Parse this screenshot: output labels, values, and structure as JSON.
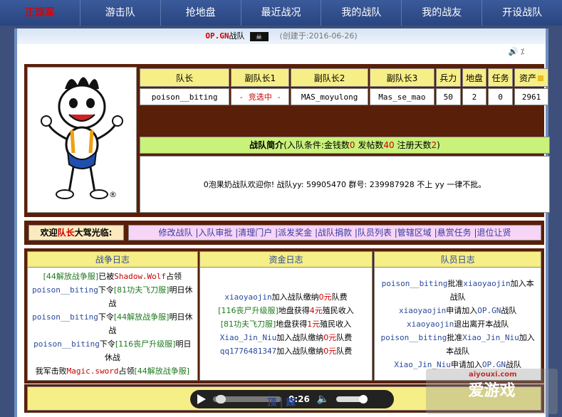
{
  "nav": {
    "items": [
      "正规军",
      "游击队",
      "抢地盘",
      "最近战况",
      "我的战队",
      "我的战友",
      "开设战队"
    ]
  },
  "header": {
    "team_code": "OP.GN",
    "team_suffix": "战队",
    "created": "(创建于:2016-06-26)"
  },
  "stats": {
    "headers": [
      "队长",
      "副队长1",
      "副队长2",
      "副队长3",
      "兵力",
      "地盘",
      "任务",
      "资产"
    ],
    "values": [
      "poison__biting",
      "- 竞选中 -",
      "MAS_moyulong",
      "Mas_se_mao",
      "50",
      "2",
      "0",
      "2961"
    ]
  },
  "intro": {
    "title": "战队简介",
    "cond_prefix": "(入队条件:金钱数",
    "money": "0",
    "posts_label": " 发帖数",
    "posts": "40",
    "days_label": " 注册天数",
    "days": "2",
    "cond_suffix": ")",
    "body": "0泡果奶战队欢迎你! 战队yy: 59905470 群号: 239987928 不上 yy 一律不批。"
  },
  "welcome": {
    "prefix": "欢迎",
    "role": "队长",
    "suffix": "大驾光临:",
    "links": [
      "修改战队",
      "入队审批",
      "清理门户",
      "派发奖金",
      "战队捐款",
      "队员列表",
      "管辖区域",
      "悬赏任务",
      "退位让贤"
    ]
  },
  "logs": {
    "war_title": "战争日志",
    "money_title": "资金日志",
    "member_title": "队员日志",
    "war": [
      {
        "a": "[44解放战争服]",
        "b": "已被",
        "c": "Shadow.Wolf",
        "d": "占领"
      },
      {
        "a": "poison__biting",
        "b": "下令",
        "c": "[81功夫飞刀服]",
        "d": "明日休战"
      },
      {
        "a": "poison__biting",
        "b": "下令",
        "c": "[44解放战争服]",
        "d": "明日休战"
      },
      {
        "a": "poison__biting",
        "b": "下令",
        "c": "[116丧尸升级服]",
        "d": "明日休战"
      },
      {
        "a": "我军击败",
        "b": "Magic.sword",
        "c": "占领",
        "d": "[44解放战争服]"
      }
    ],
    "money": [
      {
        "a": "xiaoyaojin",
        "b": "加入战队缴纳",
        "c": "0元",
        "d": "队费"
      },
      {
        "a": "[116丧尸升级服]",
        "b": "地盘获得",
        "c": "4元",
        "d": "殖民收入"
      },
      {
        "a": "[81功夫飞刀服]",
        "b": "地盘获得",
        "c": "1元",
        "d": "殖民收入"
      },
      {
        "a": "Xiao_Jin_Niu",
        "b": "加入战队缴纳",
        "c": "0元",
        "d": "队费"
      },
      {
        "a": "qq1776481347",
        "b": "加入战队缴纳",
        "c": "0元",
        "d": "队费"
      }
    ],
    "members": [
      {
        "a": "poison__biting",
        "b": "批准",
        "c": "xiaoyaojin",
        "d": "加入本战队"
      },
      {
        "a": "xiaoyaojin",
        "b": "申请加入",
        "c": "OP.GN",
        "d": "战队"
      },
      {
        "a": "xiaoyaojin",
        "b": "退出离开本战队",
        "c": "",
        "d": ""
      },
      {
        "a": "poison__biting",
        "b": "批准",
        "c": "Xiao_Jin_Niu",
        "d": "加入本战队"
      },
      {
        "a": "Xiao_Jin_Niu",
        "b": "申请加入",
        "c": "OP.GN",
        "d": "战队"
      }
    ]
  },
  "media": {
    "time": "0:26",
    "progress": 0.05,
    "volume": 0.9
  },
  "footer": {
    "first": "顶",
    "sep": "|",
    "second": "踩"
  },
  "watermark": {
    "text": "爱游戏",
    "small": "aiyouxi.com"
  },
  "colors": {
    "nav_bg": "#2a4580",
    "panel_brown": "#5a1f08",
    "header_yellow": "#f6ee86",
    "intro_green": "#c8f27a",
    "links_pink": "#f6d5f6"
  }
}
